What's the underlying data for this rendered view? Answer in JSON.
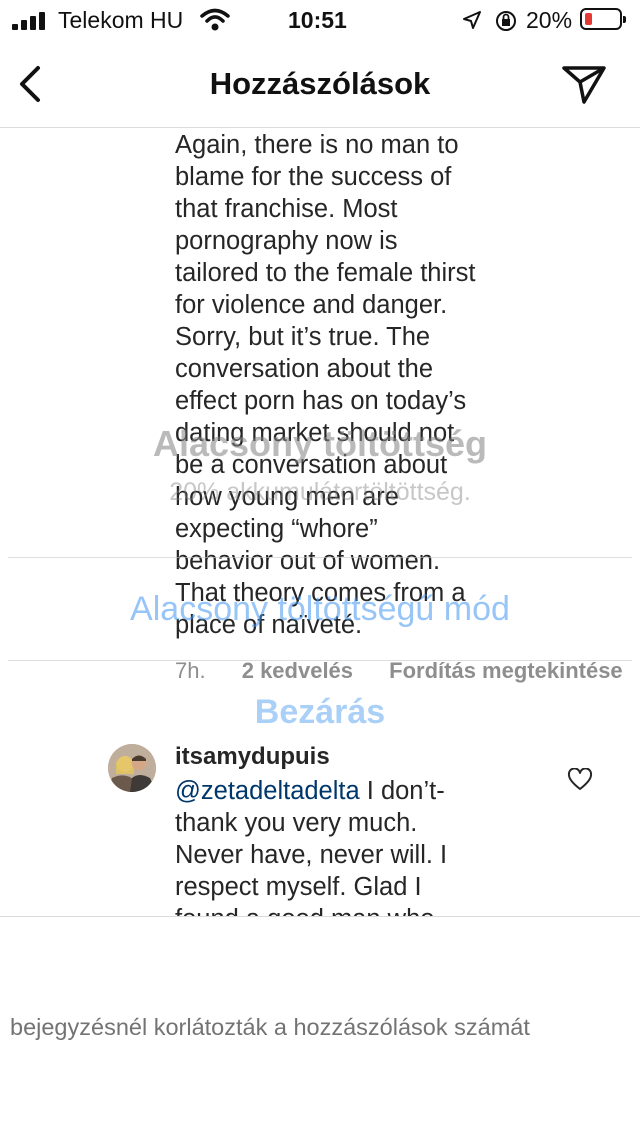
{
  "status_bar": {
    "carrier": "Telekom HU",
    "time": "10:51",
    "battery_percent": "20%",
    "battery_level": 0.2,
    "icons": [
      "signal-icon",
      "wifi-icon",
      "location-icon",
      "orientation-lock-icon",
      "battery-icon"
    ]
  },
  "header": {
    "title": "Hozzászólások",
    "back_icon": "chevron-left-icon",
    "share_icon": "paper-plane-icon"
  },
  "comments": [
    {
      "text": "Again, there is no man to\nblame for the success of\nthat franchise. Most\npornography now is\ntailored to the female thirst\nfor violence and danger.\nSorry, but it’s true. The\nconversation about the\neffect porn has on today’s\ndating market should not\nbe a conversation about\nhow young men are\nexpecting “whore”\nbehavior out of women.\nThat theory comes from a\nplace of naïveté.",
      "time": "7h.",
      "likes": "2 kedvelés",
      "translate": "Fordítás megtekintése"
    },
    {
      "username": "itsamydupuis",
      "mention": "@zetadeltadelta",
      "text": " I don’t-\nthank you very much.\nNever have, never will. I\nrespect myself. Glad I\nfound a good man who"
    }
  ],
  "overlay": {
    "title": "Alacsony töltöttség",
    "subtitle": "20% akkumulátortöltöttség.",
    "low_power_button": "Alacsony töltöttségű mód",
    "close_button": "Bezárás"
  },
  "footer": {
    "text": "bejegyzésnél korlátozták a hozzászólások számát"
  },
  "colors": {
    "mention": "#00376b",
    "meta": "#8e8e8e",
    "overlay_button": "#4296f0"
  }
}
